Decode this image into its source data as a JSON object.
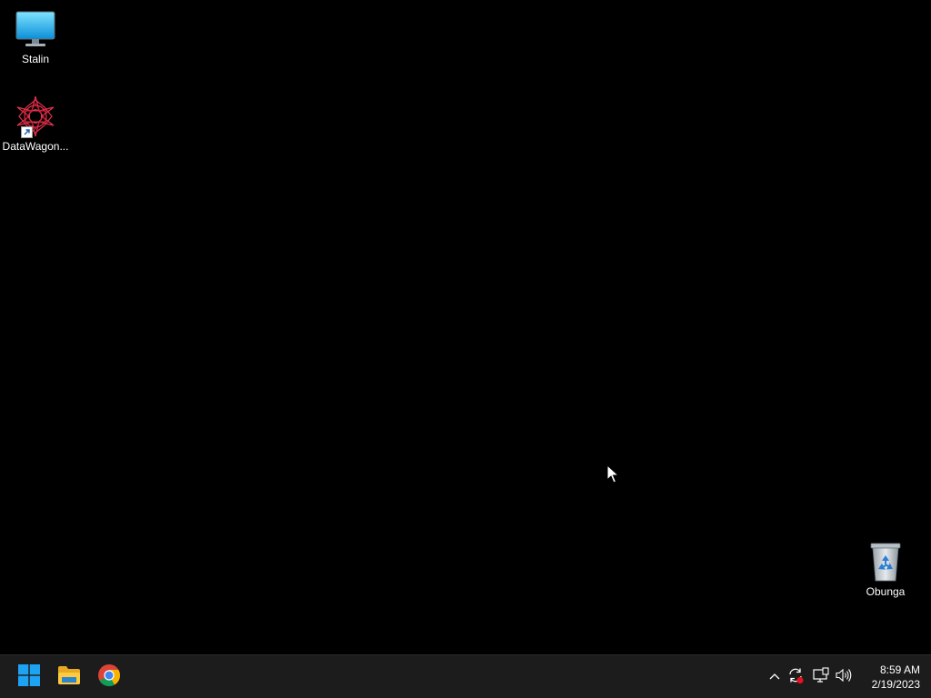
{
  "desktop": {
    "icons": [
      {
        "label": "Stalin",
        "icon": "monitor-icon"
      },
      {
        "label": "DataWagon...",
        "icon": "datawagon-app-icon",
        "shortcut": true
      },
      {
        "label": "Obunga",
        "icon": "recycle-bin-icon"
      }
    ]
  },
  "taskbar": {
    "pinned": [
      {
        "name": "Start",
        "icon": "windows-logo-icon"
      },
      {
        "name": "File Explorer",
        "icon": "folder-icon"
      },
      {
        "name": "Google Chrome",
        "icon": "chrome-icon"
      }
    ],
    "tray": [
      {
        "icon": "chevron-up-icon"
      },
      {
        "icon": "windows-update-icon"
      },
      {
        "icon": "network-icon"
      },
      {
        "icon": "volume-icon"
      }
    ],
    "clock": {
      "time": "8:59 AM",
      "date": "2/19/2023"
    }
  },
  "colors": {
    "desktop_background": "#000000",
    "taskbar_background": "#1c1c1c",
    "accent": "#0078d4"
  }
}
